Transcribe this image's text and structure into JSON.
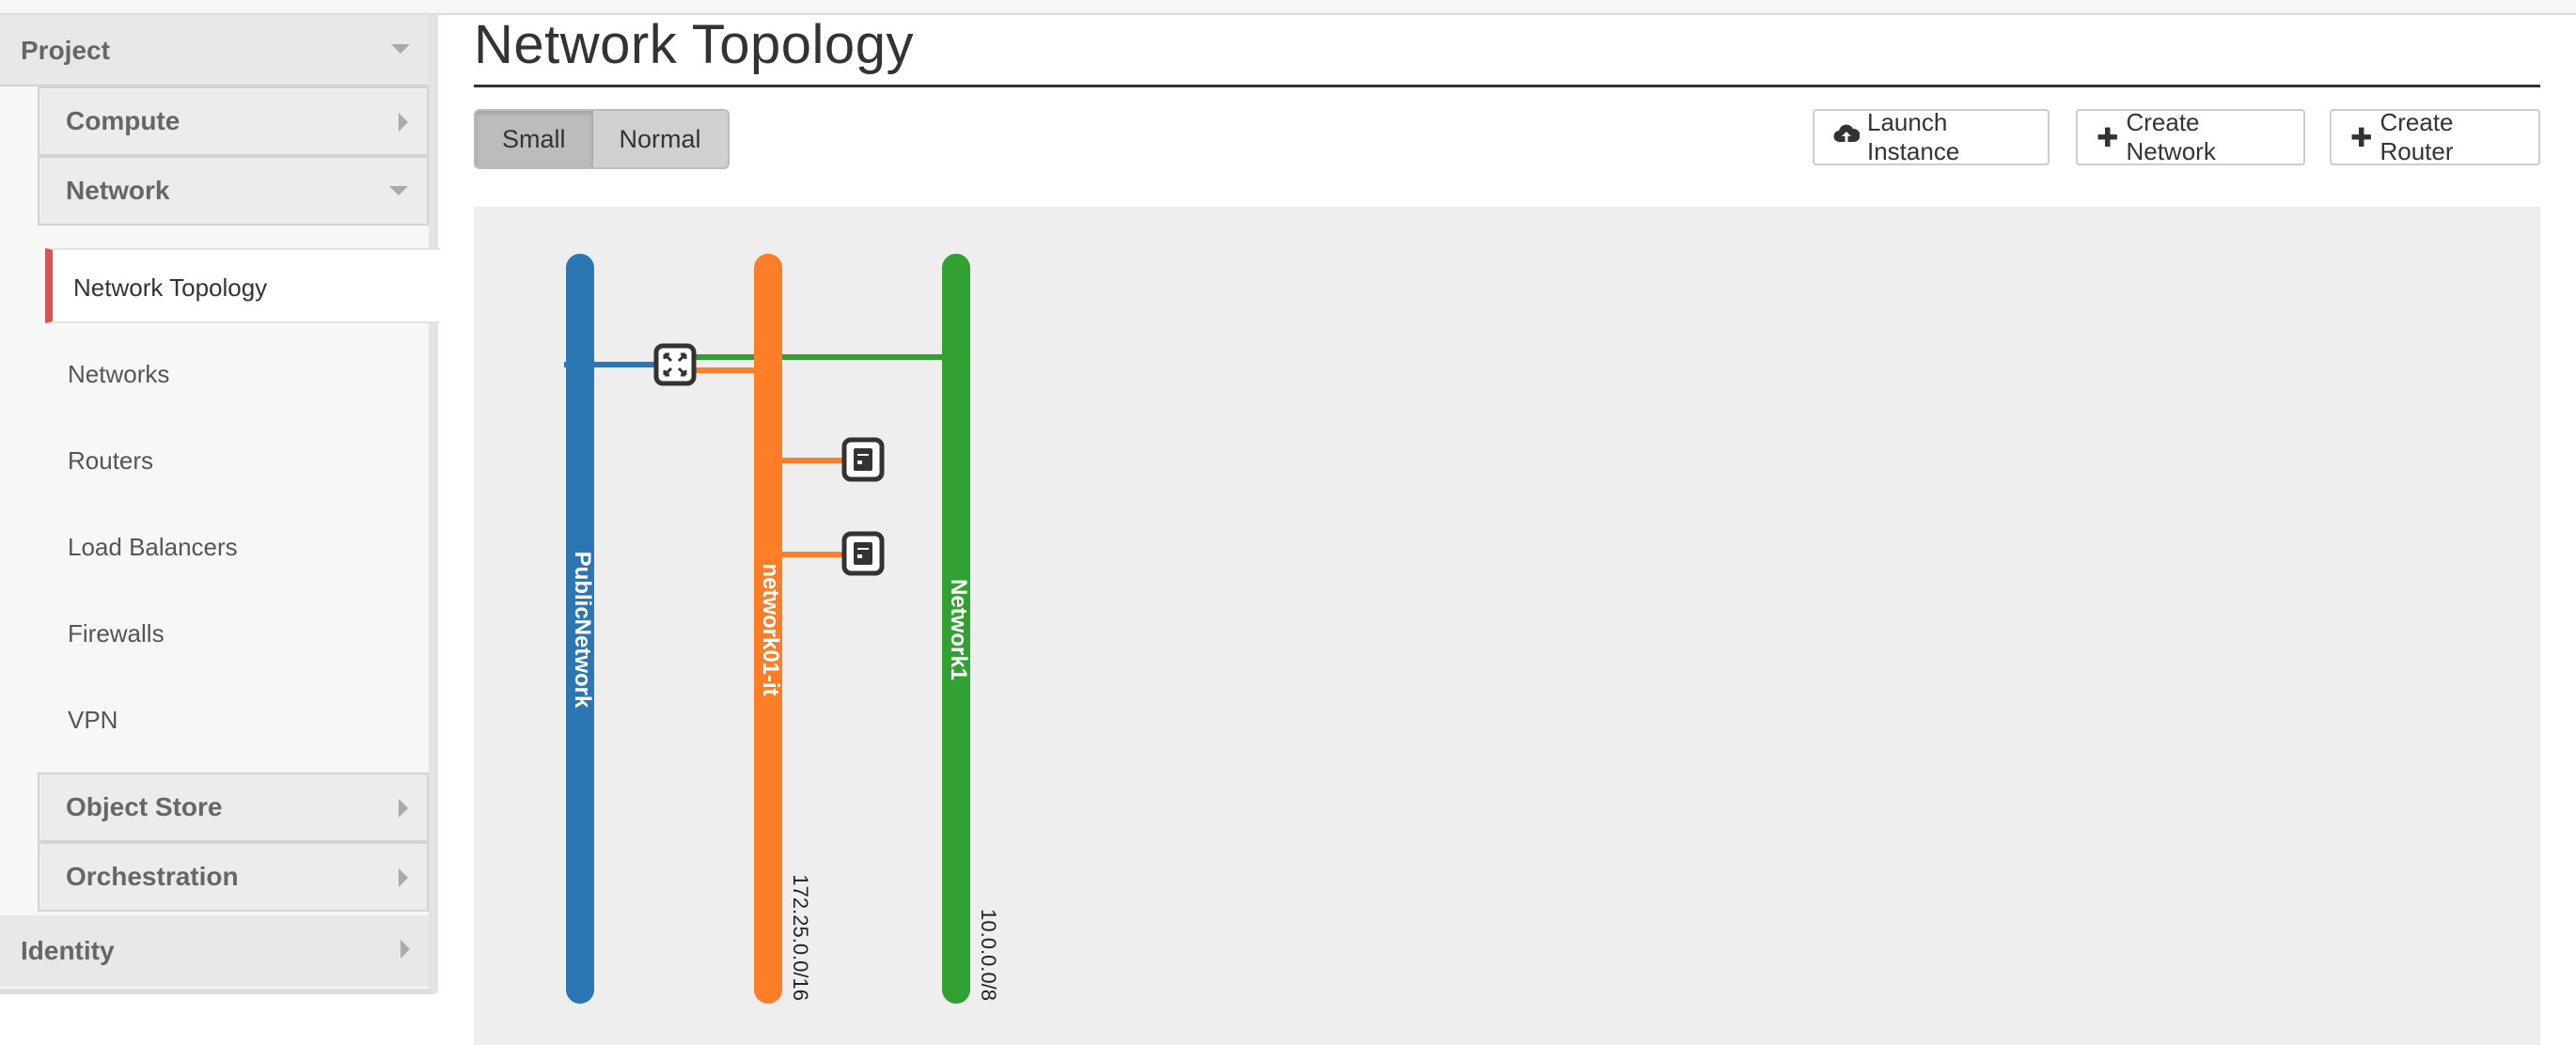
{
  "sidebar": {
    "project_label": "Project",
    "compute_label": "Compute",
    "network_label": "Network",
    "network_items": [
      "Network Topology",
      "Networks",
      "Routers",
      "Load Balancers",
      "Firewalls",
      "VPN"
    ],
    "object_store_label": "Object Store",
    "orchestration_label": "Orchestration",
    "identity_label": "Identity",
    "active_item": "Network Topology",
    "active_accent": "#d9534f"
  },
  "page": {
    "title": "Network Topology"
  },
  "view_toggle": {
    "small_label": "Small",
    "normal_label": "Normal",
    "selected": "Small"
  },
  "toolbar": {
    "launch_instance_label": "Launch Instance",
    "create_network_label": "Create Network",
    "create_router_label": "Create Router"
  },
  "topology": {
    "networks": [
      {
        "name": "PublicNetwork",
        "cidr": "",
        "color": "#2a77b4"
      },
      {
        "name": "network01-it",
        "cidr": "172.25.0.0/16",
        "color": "#fd7e26"
      },
      {
        "name": "Network1",
        "cidr": "10.0.0.0/8",
        "color": "#31a131"
      }
    ],
    "router_icon": "router-icon",
    "instance_icon": "server-icon"
  }
}
